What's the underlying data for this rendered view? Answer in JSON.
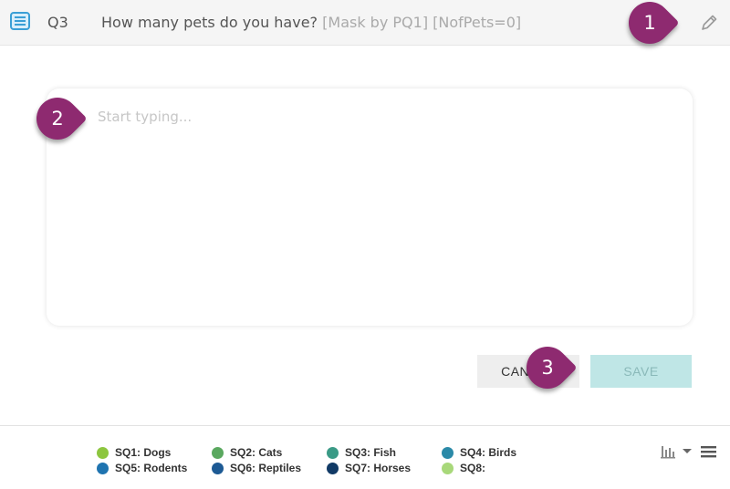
{
  "question": {
    "id": "Q3",
    "text": "How many pets do you have?",
    "meta": "[Mask by PQ1] [NofPets=0]"
  },
  "editor": {
    "placeholder": "Start typing..."
  },
  "buttons": {
    "cancel_label": "CANCEL",
    "save_label": "SAVE"
  },
  "callouts": [
    "1",
    "2",
    "3"
  ],
  "legend": [
    {
      "label": "SQ1: Dogs",
      "color": "#8dc63f"
    },
    {
      "label": "SQ2: Cats",
      "color": "#5aa85f"
    },
    {
      "label": "SQ3: Fish",
      "color": "#3a9a86"
    },
    {
      "label": "SQ4: Birds",
      "color": "#2b8aa8"
    },
    {
      "label": "SQ5: Rodents",
      "color": "#1f74b0"
    },
    {
      "label": "SQ6: Reptiles",
      "color": "#1d5a94"
    },
    {
      "label": "SQ7: Horses",
      "color": "#113a66"
    },
    {
      "label": "SQ8:",
      "color": "#a8d87a"
    }
  ],
  "icons": {
    "question_type": "list-icon",
    "edit": "pencil-icon",
    "chart": "bar-chart-icon",
    "dropdown": "caret-down-icon",
    "menu": "hamburger-menu-icon"
  },
  "colors": {
    "callout": "#8e2a70",
    "accent": "#3a9fd6",
    "save_bg": "#bfe6e6"
  }
}
